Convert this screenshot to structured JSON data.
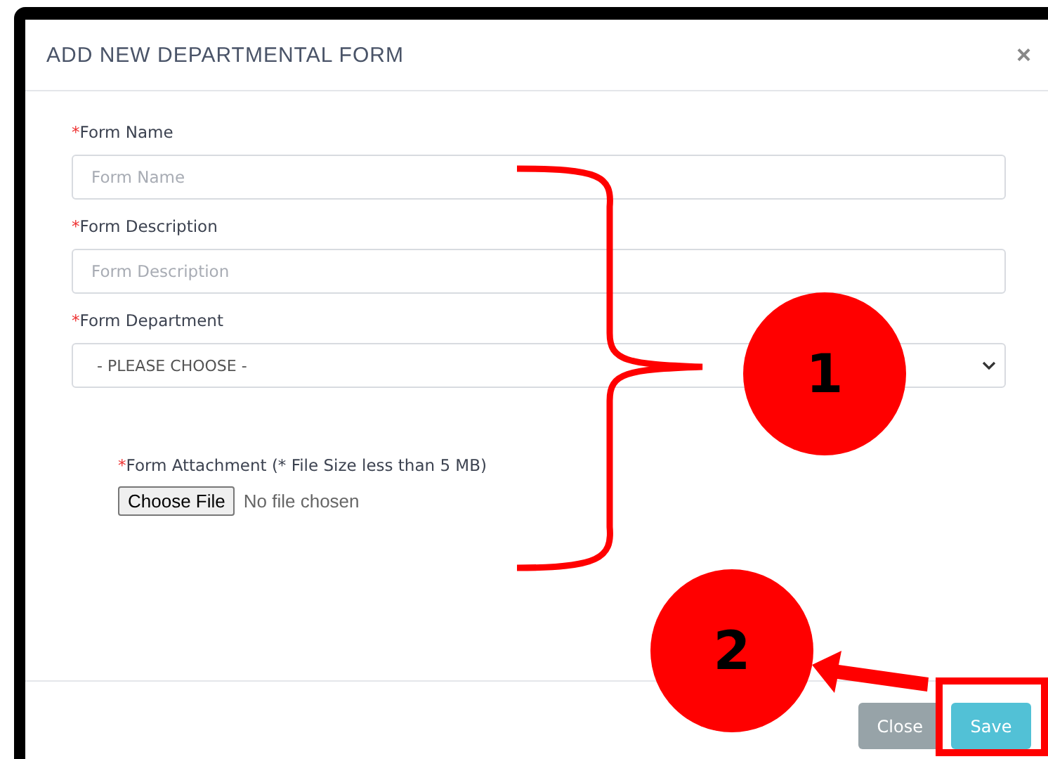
{
  "dialog": {
    "title": "ADD NEW DEPARTMENTAL FORM",
    "close_icon": "×"
  },
  "fields": [
    {
      "kind": "text",
      "required_mark": "*",
      "label": "Form Name",
      "placeholder": "Form Name"
    },
    {
      "kind": "text",
      "required_mark": "*",
      "label": "Form Description",
      "placeholder": "Form Description"
    },
    {
      "kind": "select",
      "required_mark": "*",
      "label": "Form Department",
      "value": "- PLEASE CHOOSE -"
    },
    {
      "kind": "file",
      "required_mark": "*",
      "label": "Form Attachment (* File Size less than 5 MB)",
      "button": "Choose File",
      "status": "No file chosen"
    }
  ],
  "buttons": [
    {
      "label": "Close",
      "kind": "secondary"
    },
    {
      "label": "Save",
      "kind": "primary"
    }
  ],
  "annotations": [
    {
      "label": "1"
    },
    {
      "label": "2"
    }
  ]
}
